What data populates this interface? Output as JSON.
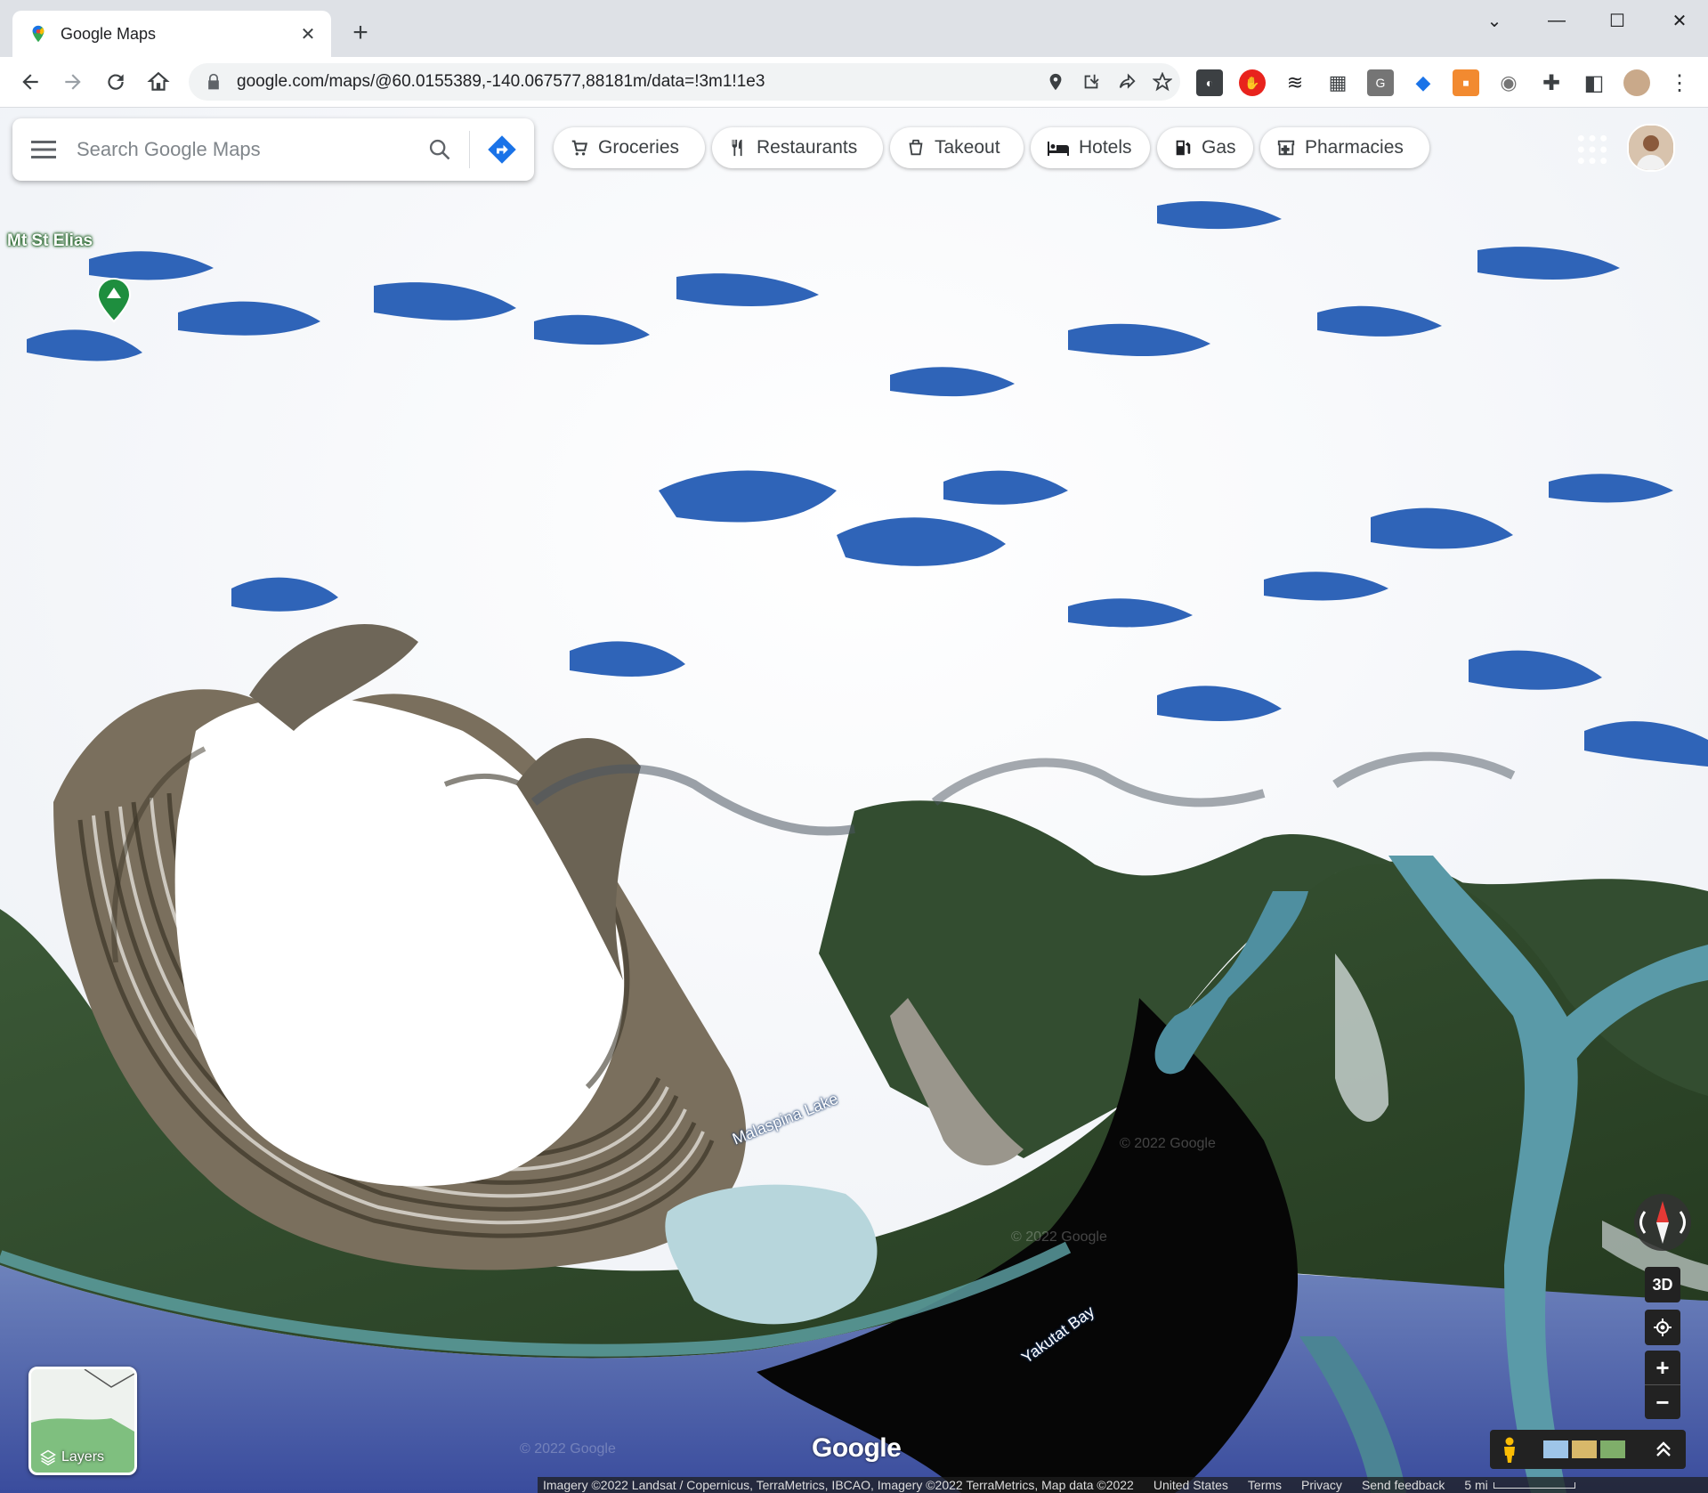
{
  "browser": {
    "tab_title": "Google Maps",
    "new_tab": "+",
    "tab_close": "✕",
    "url": "google.com/maps/@60.0155389,-140.067577,88181m/data=!3m1!1e3",
    "window_controls": {
      "dropdown": "⌄",
      "minimize": "—",
      "maximize": "☐",
      "close": "✕"
    }
  },
  "maps": {
    "search_placeholder": "Search Google Maps",
    "chips": [
      {
        "label": "Groceries",
        "icon": "cart-icon"
      },
      {
        "label": "Restaurants",
        "icon": "fork-knife-icon"
      },
      {
        "label": "Takeout",
        "icon": "takeout-bag-icon"
      },
      {
        "label": "Hotels",
        "icon": "bed-icon"
      },
      {
        "label": "Gas",
        "icon": "gas-pump-icon"
      },
      {
        "label": "Pharmacies",
        "icon": "pharmacy-icon"
      }
    ],
    "places": {
      "mt_st_elias": "Mt St Elias",
      "malaspina_lake": "Malaspina Lake",
      "yakutat_bay": "Yakutat Bay"
    },
    "layers_label": "Layers",
    "three_d": "3D",
    "zoom_in": "+",
    "zoom_out": "−",
    "logo": "Google",
    "watermark": "© 2022 Google",
    "footer": {
      "attribution": "Imagery ©2022 Landsat / Copernicus, TerraMetrics, IBCAO, Imagery ©2022 TerraMetrics, Map data ©2022",
      "country": "United States",
      "terms": "Terms",
      "privacy": "Privacy",
      "feedback": "Send feedback",
      "scale": "5 mi"
    }
  },
  "colors": {
    "snow": "#fafbfd",
    "ice_blue": "#2f64b8",
    "forest": "#2f4a2c",
    "ocean": "#3d4f9e",
    "bay": "#070707",
    "river": "#5a9aa8"
  }
}
